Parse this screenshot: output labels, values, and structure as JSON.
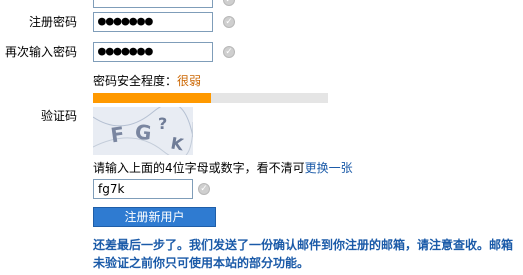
{
  "form": {
    "top_field_partial": {
      "value": ""
    },
    "password": {
      "label": "注册密码",
      "value": "●●●●●●●"
    },
    "confirm_password": {
      "label": "再次输入密码",
      "value": "●●●●●●●"
    },
    "strength": {
      "label": "密码安全程度：",
      "value_text": "很弱",
      "level_percent": 50
    },
    "captcha": {
      "label": "验证码",
      "image_text": "FG?K",
      "hint_prefix": "请输入上面的4位字母或数字，看不清可",
      "refresh_link": "更换一张",
      "input_value": "fg7k"
    },
    "submit_label": "注册新用户",
    "notice": "还差最后一步了。我们发送了一份确认邮件到你注册的邮箱，请注意查收。邮箱未验证之前你只可使用本站的部分功能。"
  },
  "colors": {
    "accent_orange": "#ff9900",
    "link_blue": "#1a5aa8",
    "button_blue": "#2f7bd1",
    "weak_text": "#cc6600"
  }
}
